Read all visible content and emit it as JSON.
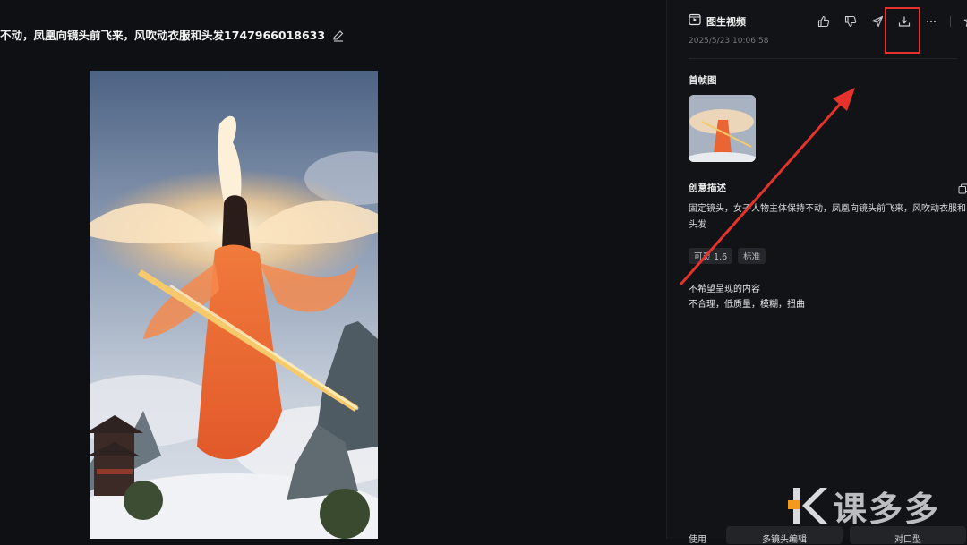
{
  "left": {
    "prompt_title": "不动，凤凰向镜头前飞来，风吹动衣服和头发1747966018633"
  },
  "panel": {
    "title": "图生视频",
    "time": "2025/5/23 10:06:58",
    "first_frame_label": "首帧图",
    "creative_label": "创意描述",
    "description": "固定镜头，女子人物主体保持不动，凤凰向镜头前飞来，风吹动衣服和头发",
    "tags": [
      "可灵 1.6",
      "标准"
    ],
    "negative_label": "不希望呈现的内容",
    "negative_value": "不合理，低质量，模糊，扭曲",
    "bottom_use": "使用",
    "bottom_multi": "多镜头编辑",
    "bottom_mouth": "对口型",
    "icons": [
      "video-icon",
      "thumbs-up-icon",
      "thumbs-down-icon",
      "send-icon",
      "download-icon",
      "more-icon",
      "star-icon",
      "copy-icon",
      "edit-icon"
    ]
  },
  "watermark": {
    "text": "课多多"
  },
  "colors": {
    "background": "#0f1013",
    "panel": "#121316",
    "highlight": "#e5322c",
    "arrow": "#e5322c"
  }
}
